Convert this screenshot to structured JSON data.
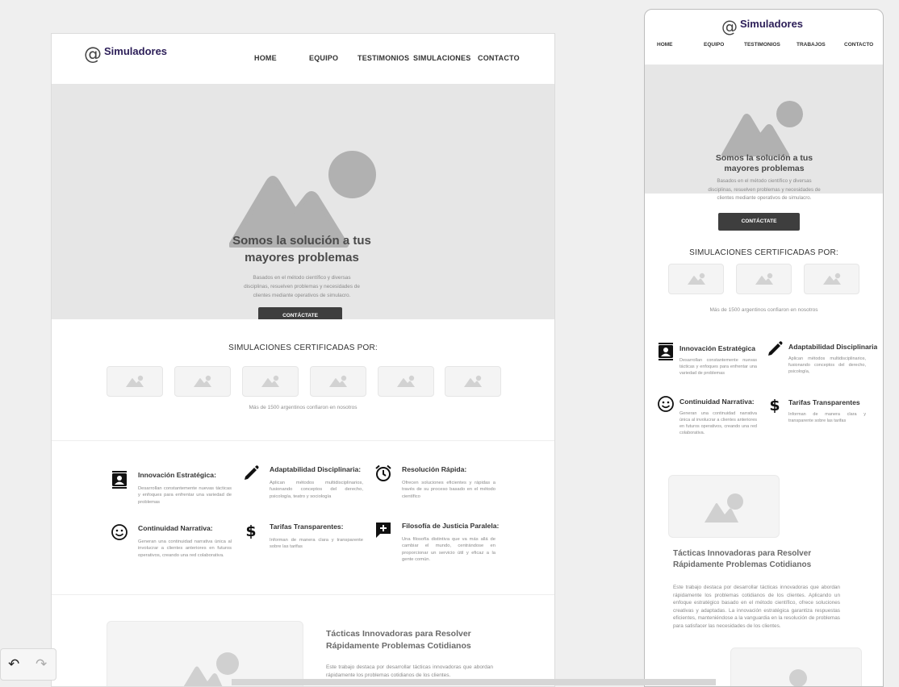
{
  "brand": {
    "at": "@",
    "name": "Simuladores"
  },
  "desktop_nav": [
    "HOME",
    "EQUIPO",
    "TESTIMONIOS",
    "SIMULACIONES",
    "CONTACTO"
  ],
  "mobile_nav": [
    "HOME",
    "EQUIPO",
    "TESTIMONIOS",
    "TRABAJOS",
    "CONTACTO"
  ],
  "hero": {
    "title_line1": "Somos la solución a tus",
    "title_line2": "mayores problemas",
    "desc_line1": "Basados en el método científico y diversas",
    "desc_line2": "disciplinas, resuelven problemas y necesidades de",
    "desc_line3": "clientes mediante operativos de simulacro.",
    "cta": "CONTÁCTATE"
  },
  "certified": {
    "title": "SIMULACIONES CERTIFICADAS POR:",
    "note": "Más de 1500 argentinos confiaron en nosotros"
  },
  "features": [
    {
      "icon": "contact-card-icon",
      "title": "Innovación Estratégica:",
      "desc": "Desarrollan constantemente nuevas tácticas y enfoques para enfrentar una variedad de problemas"
    },
    {
      "icon": "pencil-icon",
      "title": "Adaptabilidad Disciplinaria:",
      "desc": "Aplican métodos multidisciplinarios, fusionando conceptos del derecho, psicología, teatro y sociología"
    },
    {
      "icon": "alarm-clock-icon",
      "title": "Resolución Rápida:",
      "desc": "Ofrecen soluciones eficientes y rápidas a través de su proceso basado en el método científico"
    },
    {
      "icon": "smiley-icon",
      "title": "Continuidad Narrativa:",
      "desc": "Generan una continuidad narrativa única al involucrar a clientes anteriores en futuros operativos, creando una red colaborativa."
    },
    {
      "icon": "dollar-icon",
      "title": "Tarifas Transparentes:",
      "desc": "Informan de manera clara y transparente sobre las tarifas"
    },
    {
      "icon": "add-comment-icon",
      "title": "Filosofía de Justicia Paralela:",
      "desc": "Una filosofía distintiva que va más allá de cambiar el mundo, centrándose en proporcionar un servicio útil y eficaz a la gente común."
    }
  ],
  "mobile_features": [
    {
      "title": "Innovación Estratégica",
      "desc": "Desarrollan constantemente nuevas tácticas y enfoques para enfrentar una variedad de problemas"
    },
    {
      "title": "Adaptabilidad Disciplinaria",
      "desc": "Aplican métodos multidisciplinarios, fusionando conceptos del derecho, psicología,"
    },
    {
      "title": "Continuidad Narrativa:",
      "desc": "Generan una continuidad narrativa única al involucrar a clientes anteriores en futuros operativos, creando una red colaborativa."
    },
    {
      "title": "Tarifas Transparentes",
      "desc": "Informan de manera clara y transparente sobre las tarifas"
    }
  ],
  "article": {
    "title_line1": "Tácticas Innovadoras para Resolver",
    "title_line2": "Rápidamente Problemas Cotidianos",
    "desktop_body": "Este trabajo destaca por desarrollar tácticas innovadoras que abordan rápidamente los problemas cotidianos de los clientes.",
    "mobile_body": "Este trabajo destaca por desarrollar tácticas innovadoras que abordan rápidamente los problemas cotidianos de los clientes. Aplicando un enfoque estratégico basado en el método científico, ofrece soluciones creativas y adaptadas. La innovación estratégica garantiza respuestas eficientes, manteniéndose a la vanguardia en la resolución de problemas para satisfacer las necesidades de los clientes."
  },
  "colors": {
    "brand": "#2b1d57",
    "button": "#3e3e3e",
    "placeholder": "#b1b1b1",
    "hero_bg": "#e6e6e6"
  }
}
